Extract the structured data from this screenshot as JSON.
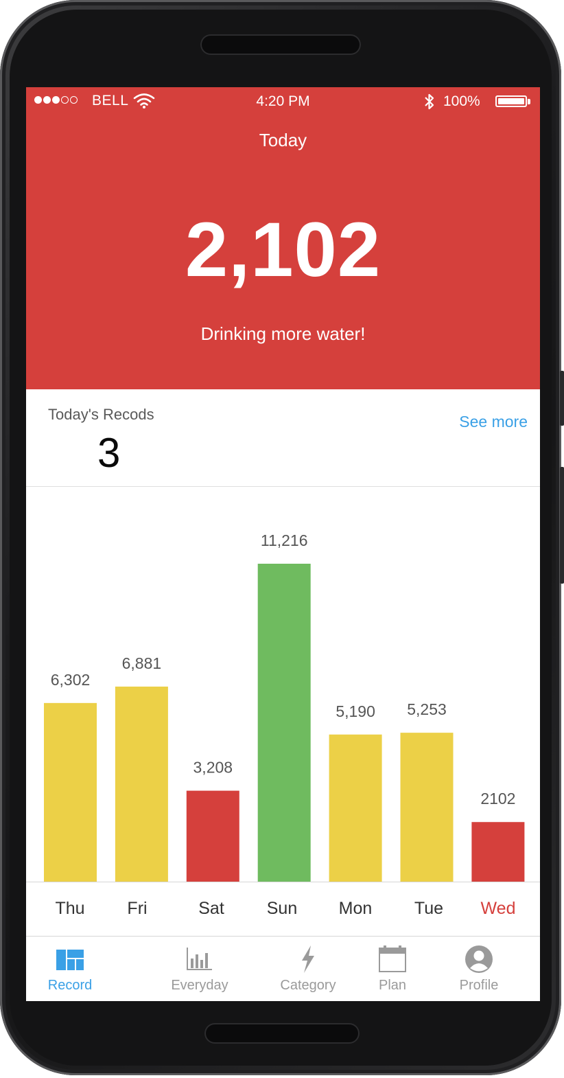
{
  "status_bar": {
    "carrier": "BELL",
    "time": "4:20 PM",
    "battery": "100%",
    "signal_strength": 3,
    "signal_max": 5
  },
  "hero": {
    "title": "Today",
    "value": "2,102",
    "message": "Drinking more water!",
    "background_color": "#d5403c"
  },
  "records": {
    "label": "Today's Recods",
    "count": "3",
    "see_more": "See more"
  },
  "chart_data": {
    "type": "bar",
    "categories": [
      "Thu",
      "Fri",
      "Sat",
      "Sun",
      "Mon",
      "Tue",
      "Wed"
    ],
    "values": [
      6302,
      6881,
      3208,
      11216,
      5190,
      5253,
      2102
    ],
    "value_labels": [
      "6,302",
      "6,881",
      "3,208",
      "11,216",
      "5,190",
      "5,253",
      "2102"
    ],
    "colors": [
      "#ecd047",
      "#ecd047",
      "#d5403c",
      "#6fbb5f",
      "#ecd047",
      "#ecd047",
      "#d5403c"
    ],
    "highlight_category": "Wed",
    "highlight_color": "#d5403c",
    "title": "",
    "xlabel": "",
    "ylabel": "",
    "ylim": [
      0,
      11216
    ],
    "grid": false,
    "legend": "none"
  },
  "tabs": [
    {
      "label": "Record",
      "icon": "dashboard-icon",
      "active": true
    },
    {
      "label": "Everyday",
      "icon": "bar-chart-icon",
      "active": false
    },
    {
      "label": "Category",
      "icon": "lightning-icon",
      "active": false
    },
    {
      "label": "Plan",
      "icon": "calendar-icon",
      "active": false
    },
    {
      "label": "Profile",
      "icon": "profile-icon",
      "active": false
    }
  ],
  "colors": {
    "accent": "#3aa0e6",
    "inactive_tab": "#9a9a9a",
    "good": "#6fbb5f",
    "medium": "#ecd047",
    "bad": "#d5403c"
  }
}
